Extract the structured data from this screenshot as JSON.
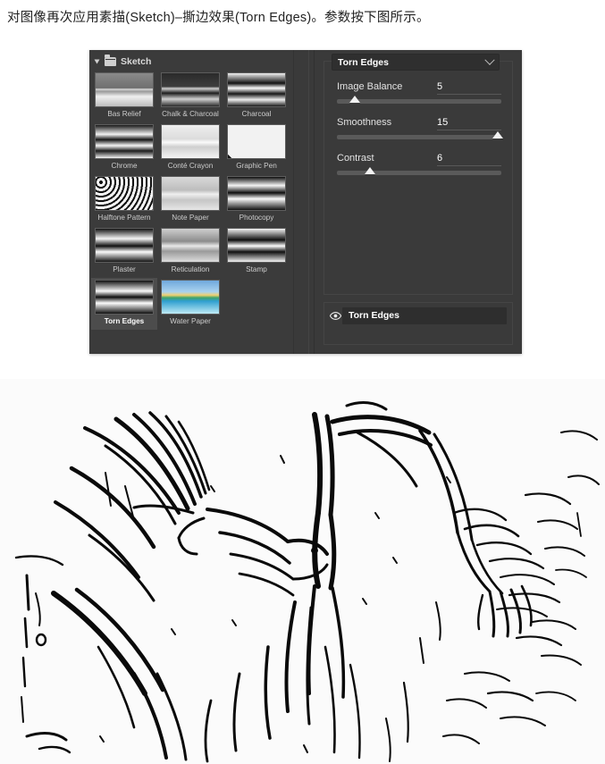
{
  "caption": "对图像再次应用素描(Sketch)–撕边效果(Torn Edges)。参数按下图所示。",
  "dialog": {
    "gallery": {
      "group_label": "Sketch",
      "disclosure_icon": "triangle-down-icon",
      "folder_icon": "folder-icon",
      "filters": [
        {
          "label": "Bas Relief",
          "selected": false
        },
        {
          "label": "Chalk & Charcoal",
          "selected": false
        },
        {
          "label": "Charcoal",
          "selected": false
        },
        {
          "label": "Chrome",
          "selected": false
        },
        {
          "label": "Conté Crayon",
          "selected": false
        },
        {
          "label": "Graphic Pen",
          "selected": false
        },
        {
          "label": "Halftone Pattern",
          "selected": false
        },
        {
          "label": "Note Paper",
          "selected": false
        },
        {
          "label": "Photocopy",
          "selected": false
        },
        {
          "label": "Plaster",
          "selected": false
        },
        {
          "label": "Reticulation",
          "selected": false
        },
        {
          "label": "Stamp",
          "selected": false
        },
        {
          "label": "Torn Edges",
          "selected": true
        },
        {
          "label": "Water Paper",
          "selected": false
        }
      ]
    },
    "filter_select": {
      "value": "Torn Edges",
      "chevron_icon": "chevron-down-icon"
    },
    "parameters": [
      {
        "label": "Image Balance",
        "value": "5",
        "percent": 11
      },
      {
        "label": "Smoothness",
        "value": "15",
        "percent": 98
      },
      {
        "label": "Contrast",
        "value": "6",
        "percent": 20
      }
    ],
    "layers": [
      {
        "name": "Torn Edges",
        "visible": true,
        "visibility_icon": "eye-icon"
      }
    ]
  },
  "artwork": {
    "name": "torn-edges-sketch-result",
    "description": "Black and white line-art sketch of hands and bird forms"
  },
  "colors": {
    "panel_bg": "#3a3a3a",
    "gallery_bg": "#3b3b3b",
    "selected_cell": "#4c4c4c",
    "field_bg": "#2e2e2e",
    "track": "#5a5a5a",
    "knob": "#f2f2f2",
    "text": "#e2e2e2",
    "caption_text": "#222222"
  }
}
